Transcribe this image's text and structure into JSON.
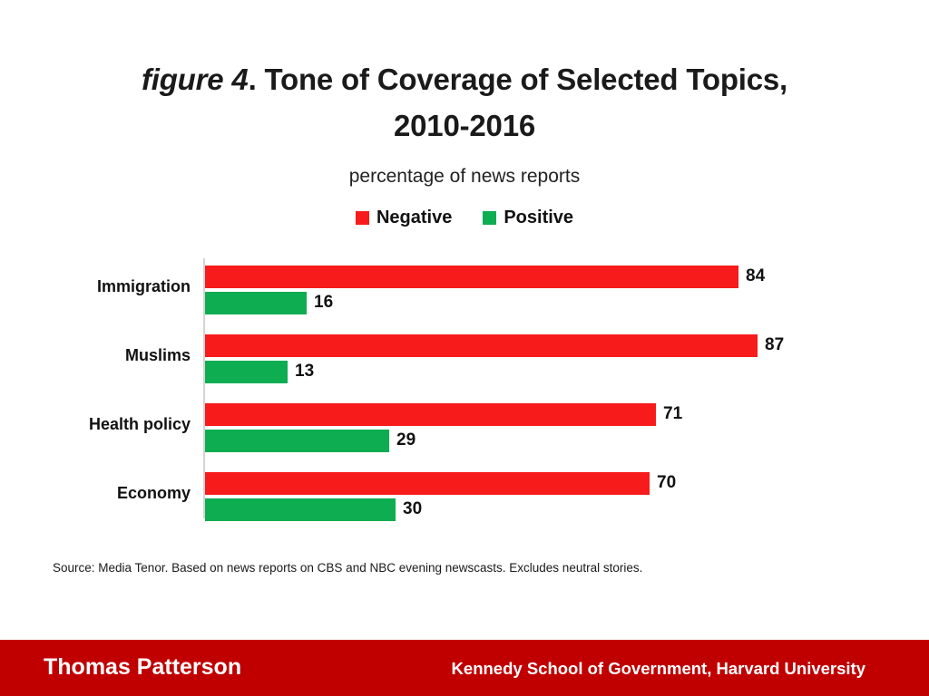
{
  "title": {
    "emphasis": "figure 4",
    "rest": ". Tone of Coverage of Selected Topics,",
    "line2": "2010-2016"
  },
  "subtitle": "percentage of news reports",
  "source_note": "Source: Media Tenor. Based on news reports on CBS and NBC evening newscasts. Excludes neutral stories.",
  "footer": {
    "author": "Thomas Patterson",
    "affiliation": "Kennedy School of Government, Harvard University",
    "band_color": "#C00000"
  },
  "chart_data": {
    "type": "bar",
    "orientation": "horizontal",
    "title": "figure 4. Tone of Coverage of Selected Topics, 2010-2016",
    "subtitle": "percentage of news reports",
    "xlabel": "",
    "ylabel": "",
    "xlim": [
      0,
      100
    ],
    "grid": false,
    "legend_position": "top-center",
    "categories": [
      "Immigration",
      "Muslims",
      "Health policy",
      "Economy"
    ],
    "series": [
      {
        "name": "Negative",
        "color": "#F71B1B",
        "values": [
          84,
          87,
          71,
          70
        ]
      },
      {
        "name": "Positive",
        "color": "#0EAD52",
        "values": [
          16,
          13,
          29,
          30
        ]
      }
    ]
  }
}
